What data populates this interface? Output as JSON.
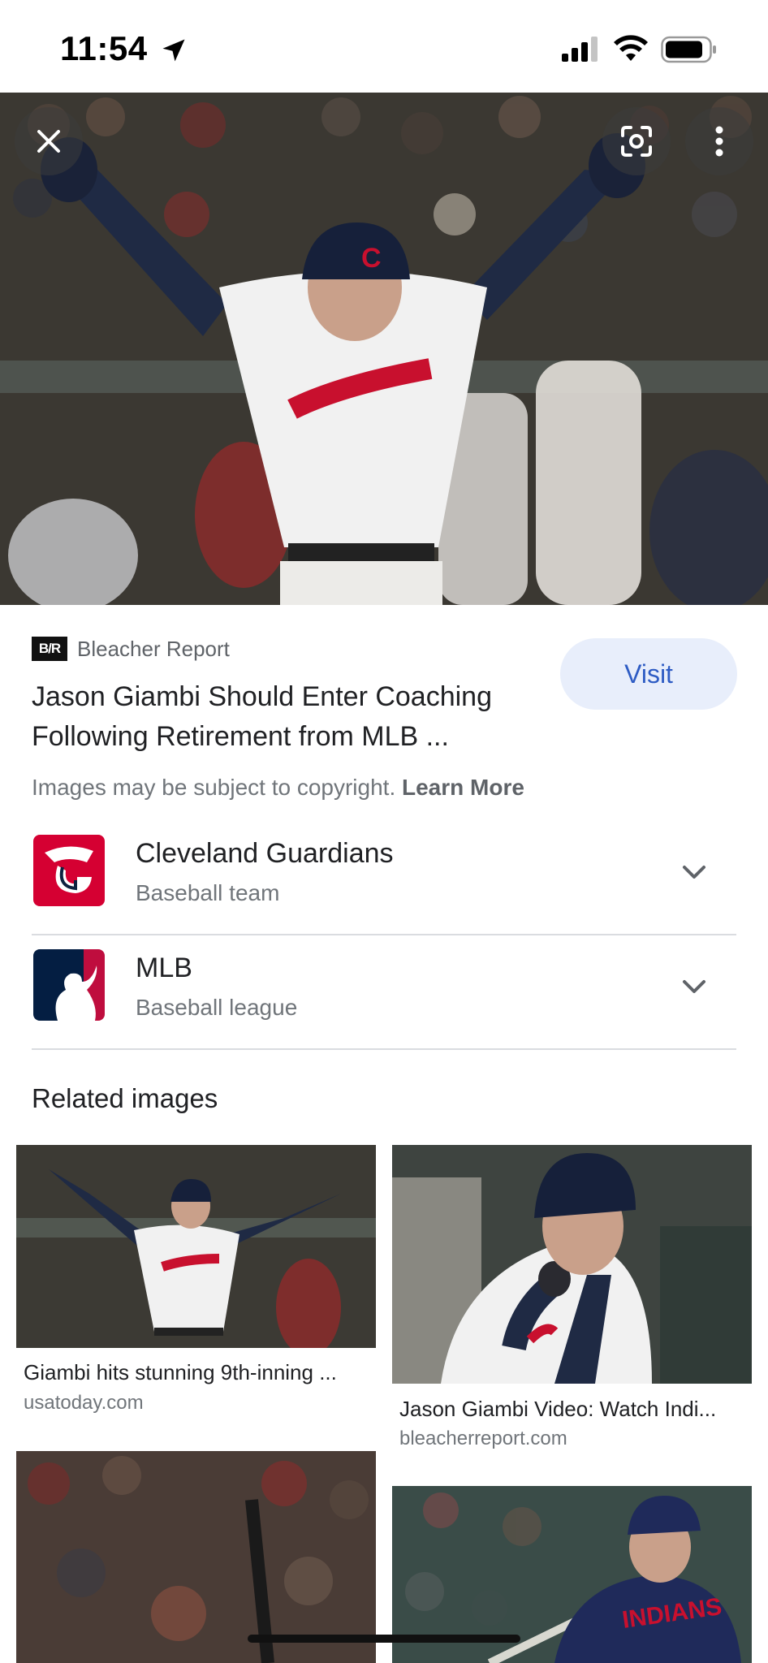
{
  "status_bar": {
    "time": "11:54"
  },
  "hero": {
    "close_icon": "close-icon",
    "lens_icon": "google-lens-icon",
    "more_icon": "more-vertical-icon"
  },
  "result": {
    "source_logo_text": "B/R",
    "source_name": "Bleacher Report",
    "visit_label": "Visit",
    "title": "Jason Giambi Should Enter Coaching Following Retirement from MLB ...",
    "copyright_text": "Images may be subject to copyright.",
    "learn_more": "Learn More"
  },
  "entities": [
    {
      "title": "Cleveland Guardians",
      "subtitle": "Baseball team"
    },
    {
      "title": "MLB",
      "subtitle": "Baseball league"
    }
  ],
  "related": {
    "heading": "Related images",
    "items": [
      {
        "caption": "Giambi hits stunning 9th-inning ...",
        "domain": "usatoday.com"
      },
      {
        "caption": "Jason Giambi Video: Watch Indi...",
        "domain": "bleacherreport.com"
      },
      {
        "caption": "",
        "domain": ""
      },
      {
        "caption": "",
        "domain": ""
      }
    ]
  },
  "colors": {
    "accent_blue": "#2e5cc4",
    "visit_bg": "#e8eefb",
    "guardians_red": "#d50032",
    "mlb_navy": "#041e42"
  }
}
